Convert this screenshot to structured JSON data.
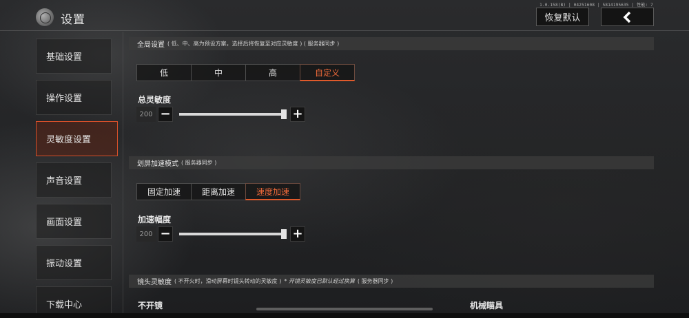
{
  "version": "1.0.158(B) | 04251608 | 5814195635 | 性能: 7",
  "header": {
    "title": "设置",
    "restore_label": "恢复默认",
    "back_icon": "chevron-left-icon"
  },
  "sidebar": {
    "items": [
      {
        "label": "基础设置",
        "active": false
      },
      {
        "label": "操作设置",
        "active": false
      },
      {
        "label": "灵敏度设置",
        "active": true
      },
      {
        "label": "声音设置",
        "active": false
      },
      {
        "label": "画面设置",
        "active": false
      },
      {
        "label": "振动设置",
        "active": false
      },
      {
        "label": "下载中心",
        "active": false
      }
    ]
  },
  "global": {
    "title": "全局设置",
    "note": "( 低、中、高为预设方案，选择后将恢复至对应灵敏度 ) ( 服务器同步 )",
    "options": [
      "低",
      "中",
      "高",
      "自定义"
    ],
    "selected": 3,
    "slider_label": "总灵敏度",
    "slider_value": "200",
    "slider_fraction": 1.0
  },
  "swipe": {
    "title": "划屏加速模式",
    "note": "( 服务器同步 )",
    "options": [
      "固定加速",
      "距离加速",
      "速度加速"
    ],
    "selected": 2,
    "slider_label": "加速幅度",
    "slider_value": "200",
    "slider_fraction": 1.0
  },
  "camera": {
    "title": "镜头灵敏度",
    "note": "( 不开火时，滑动屏幕时镜头转动的灵敏度 )",
    "note_em": "* 开镜灵敏度已默认经过换算",
    "note_tail": "( 服务器同步 )",
    "col_left": "不开镜",
    "col_right": "机械瞄具"
  },
  "colors": {
    "accent": "#e05a2b",
    "accent_text": "#f06a3a"
  }
}
